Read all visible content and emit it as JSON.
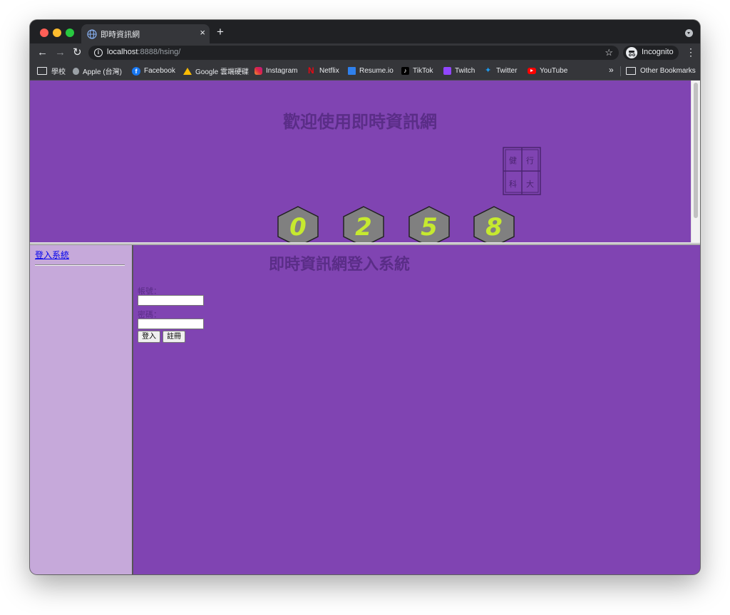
{
  "browser": {
    "tab_title": "即時資訊網",
    "tab_close": "×",
    "new_tab": "+",
    "url_host": "localhost",
    "url_path": ":8888/hsing/",
    "incognito_label": "Incognito",
    "nav_back": "←",
    "nav_forward": "→",
    "nav_reload": "↻",
    "star": "☆",
    "menu": "⋮",
    "bookmarks": [
      {
        "label": "學校",
        "icon": "folder-icon"
      },
      {
        "label": "Apple (台灣)",
        "icon": "apple-icon"
      },
      {
        "label": "Facebook",
        "icon": "facebook-icon"
      },
      {
        "label": "Google 雲端硬碟",
        "icon": "google-drive-icon"
      },
      {
        "label": "Instagram",
        "icon": "instagram-icon"
      },
      {
        "label": "Netflix",
        "icon": "netflix-icon"
      },
      {
        "label": "Resume.io",
        "icon": "resume-icon"
      },
      {
        "label": "TikTok",
        "icon": "tiktok-icon"
      },
      {
        "label": "Twitch",
        "icon": "twitch-icon"
      },
      {
        "label": "Twitter",
        "icon": "twitter-icon"
      },
      {
        "label": "YouTube",
        "icon": "youtube-icon"
      }
    ],
    "more_bookmarks": "»",
    "other_bookmarks": "Other Bookmarks"
  },
  "header": {
    "title": "歡迎使用即時資訊網",
    "seal_chars": [
      "健",
      "行",
      "科",
      "大"
    ],
    "counter_digits": [
      "0",
      "2",
      "5",
      "8"
    ]
  },
  "sidebar": {
    "login_link": "登入系統"
  },
  "main": {
    "title": "即時資訊網登入系統",
    "account_label": "帳號：",
    "account_value": "",
    "password_label": "密碼：",
    "password_value": "",
    "login_button": "登入",
    "register_button": "註冊"
  },
  "colors": {
    "page_bg": "#8044b2",
    "sidebar_bg": "#c6a9da",
    "heading": "#5a2d87",
    "hex_fill": "#808080",
    "digit_color": "#c6e92f"
  }
}
